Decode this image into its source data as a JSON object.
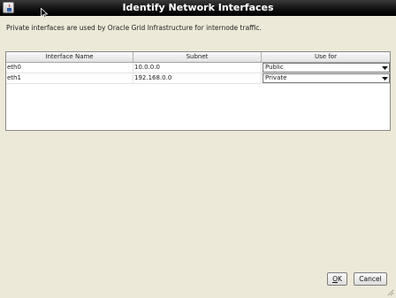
{
  "window": {
    "title": "Identify Network Interfaces",
    "app_icon": "java-icon"
  },
  "description": "Private interfaces are used by Oracle Grid Infrastructure for internode traffic.",
  "table": {
    "columns": [
      "Interface Name",
      "Subnet",
      "Use for"
    ],
    "rows": [
      {
        "interface": "eth0",
        "subnet": "10.0.0.0",
        "use_for": "Public"
      },
      {
        "interface": "eth1",
        "subnet": "192.168.0.0",
        "use_for": "Private"
      }
    ]
  },
  "buttons": {
    "ok_mnemonic": "O",
    "ok_rest": "K",
    "cancel_label": "Cancel"
  }
}
